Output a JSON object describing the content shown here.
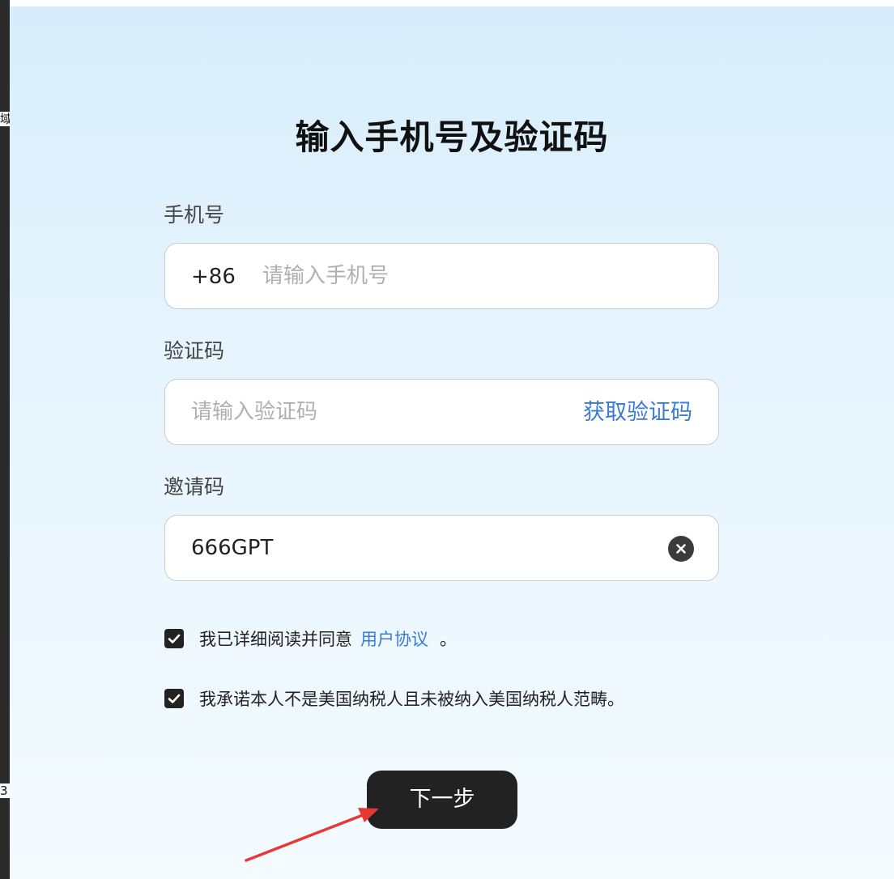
{
  "left_strip": {
    "fragments": [
      "域",
      "3"
    ]
  },
  "title": "输入手机号及验证码",
  "phone": {
    "label": "手机号",
    "country_code": "+86",
    "placeholder": "请输入手机号",
    "value": ""
  },
  "code": {
    "label": "验证码",
    "placeholder": "请输入验证码",
    "value": "",
    "get_code_label": "获取验证码"
  },
  "invite": {
    "label": "邀请码",
    "value": "666GPT",
    "clear_icon": "clear-circle-icon"
  },
  "agreement": {
    "checked": true,
    "text_before": "我已详细阅读并同意",
    "link_text": "用户协议",
    "text_after": "。"
  },
  "tax_pledge": {
    "checked": true,
    "text": "我承诺本人不是美国纳税人且未被纳入美国纳税人范畴。"
  },
  "next_button": {
    "label": "下一步"
  },
  "annotation": {
    "color": "#e53935",
    "icon": "red-arrow-annotation"
  }
}
